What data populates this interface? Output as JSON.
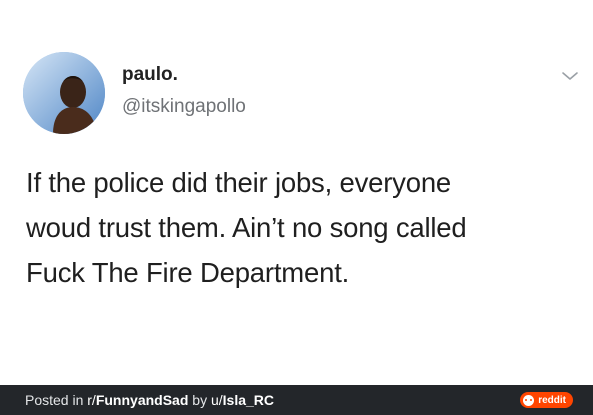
{
  "tweet": {
    "display_name": "paulo.",
    "handle": "@itskingapollo",
    "text_lines": [
      "If the police did their jobs, everyone",
      "woud trust them. Ain’t no song called",
      "Fuck The Fire Department."
    ],
    "avatar_icon": "profile-photo",
    "menu_icon": "chevron-down-icon"
  },
  "footer": {
    "prefix": "Posted in ",
    "sub_prefix": "r/",
    "subreddit": "FunnyandSad",
    "by": " by ",
    "user_prefix": "u/",
    "username": "Isla_RC",
    "brand": "reddit",
    "brand_color": "#ff4500",
    "background": "#23262a"
  }
}
